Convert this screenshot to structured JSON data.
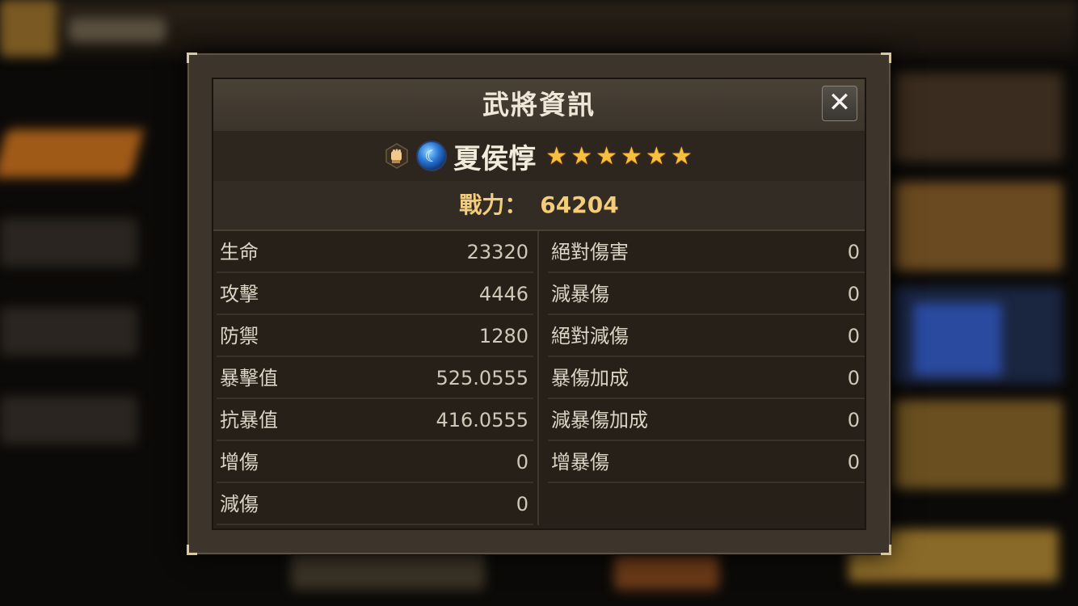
{
  "dialog": {
    "title": "武將資訊",
    "close_label": "✕"
  },
  "hero": {
    "name": "夏侯惇",
    "class_icon": "fist-icon",
    "element_icon": "water-moon-icon",
    "element_glyph": "☾",
    "stars": 6,
    "star_glyph": "★"
  },
  "power": {
    "label": "戰力：",
    "value": "64204"
  },
  "stats_left": [
    {
      "label": "生命",
      "value": "23320"
    },
    {
      "label": "攻擊",
      "value": "4446"
    },
    {
      "label": "防禦",
      "value": "1280"
    },
    {
      "label": "暴擊值",
      "value": "525.0555"
    },
    {
      "label": "抗暴值",
      "value": "416.0555"
    },
    {
      "label": "增傷",
      "value": "0"
    },
    {
      "label": "減傷",
      "value": "0"
    }
  ],
  "stats_right": [
    {
      "label": "絕對傷害",
      "value": "0"
    },
    {
      "label": "減暴傷",
      "value": "0"
    },
    {
      "label": "絕對減傷",
      "value": "0"
    },
    {
      "label": "暴傷加成",
      "value": "0"
    },
    {
      "label": "減暴傷加成",
      "value": "0"
    },
    {
      "label": "增暴傷",
      "value": "0"
    }
  ],
  "colors": {
    "power_text": "#f3cd7a",
    "star": "#f4c040",
    "panel_bg": "#262019"
  }
}
